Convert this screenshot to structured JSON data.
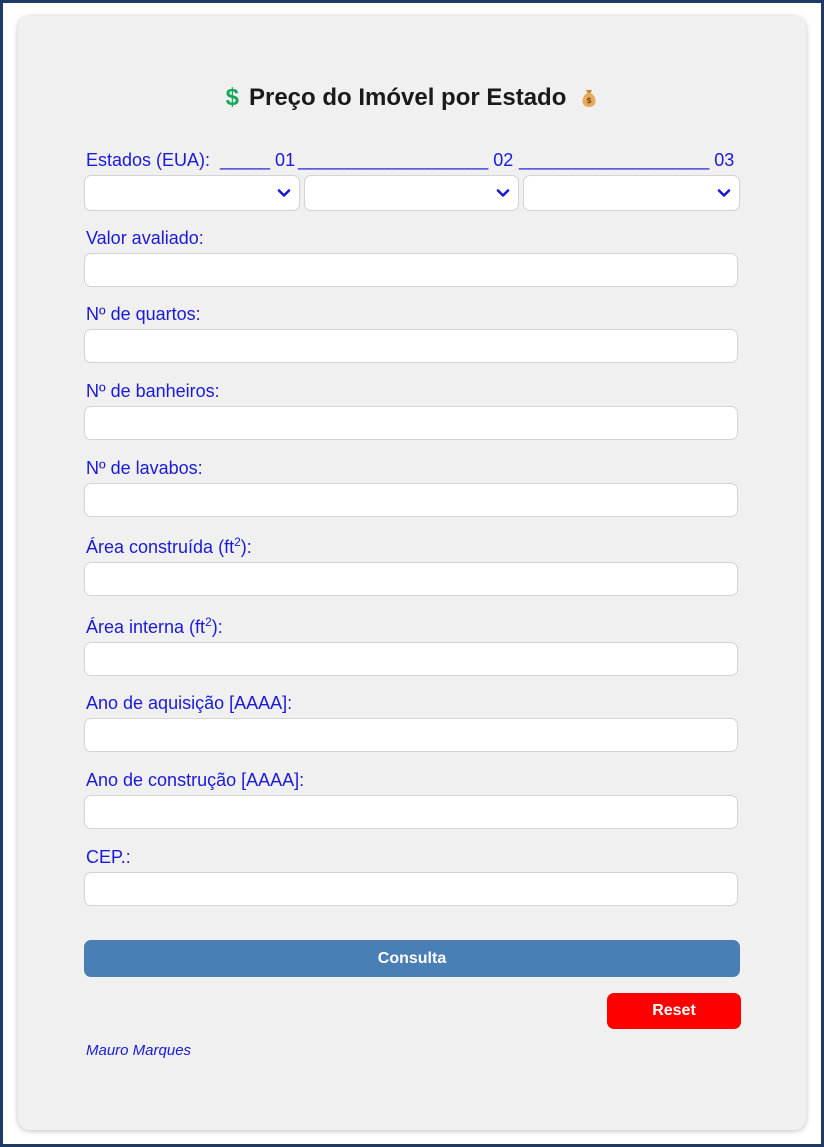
{
  "header": {
    "dollar": "$",
    "title": "Preço do Imóvel por Estado",
    "icon": "money-bag-icon"
  },
  "states": {
    "label": "Estados (EUA):",
    "segment_1": "_____ 01",
    "segment_2": "___________________ 02",
    "segment_3": "___________________ 03",
    "select_values": [
      "",
      "",
      ""
    ]
  },
  "fields": {
    "valor_avaliado": {
      "label": "Valor avaliado:",
      "value": ""
    },
    "quartos": {
      "label": "Nº de quartos:",
      "value": ""
    },
    "banheiros": {
      "label": "Nº de banheiros:",
      "value": ""
    },
    "lavabos": {
      "label": "Nº de lavabos:",
      "value": ""
    },
    "area_construida": {
      "label_prefix": "Área construída (ft",
      "label_sup": "2",
      "label_suffix": "):",
      "value": ""
    },
    "area_interna": {
      "label_prefix": "Área interna (ft",
      "label_sup": "2",
      "label_suffix": "):",
      "value": ""
    },
    "ano_aquisicao": {
      "label": "Ano de aquisição [AAAA]:",
      "value": ""
    },
    "ano_construcao": {
      "label": "Ano de construção [AAAA]:",
      "value": ""
    },
    "cep": {
      "label": "CEP.:",
      "value": ""
    }
  },
  "actions": {
    "consulta_label": "Consulta",
    "reset_label": "Reset"
  },
  "footer": {
    "author": "Mauro Marques"
  },
  "colors": {
    "label": "#1a1ad8",
    "consulta_button": "#4a7fb5",
    "reset_button": "#ff0000",
    "dollar": "#15a85a",
    "frame_border": "#1f3864"
  }
}
